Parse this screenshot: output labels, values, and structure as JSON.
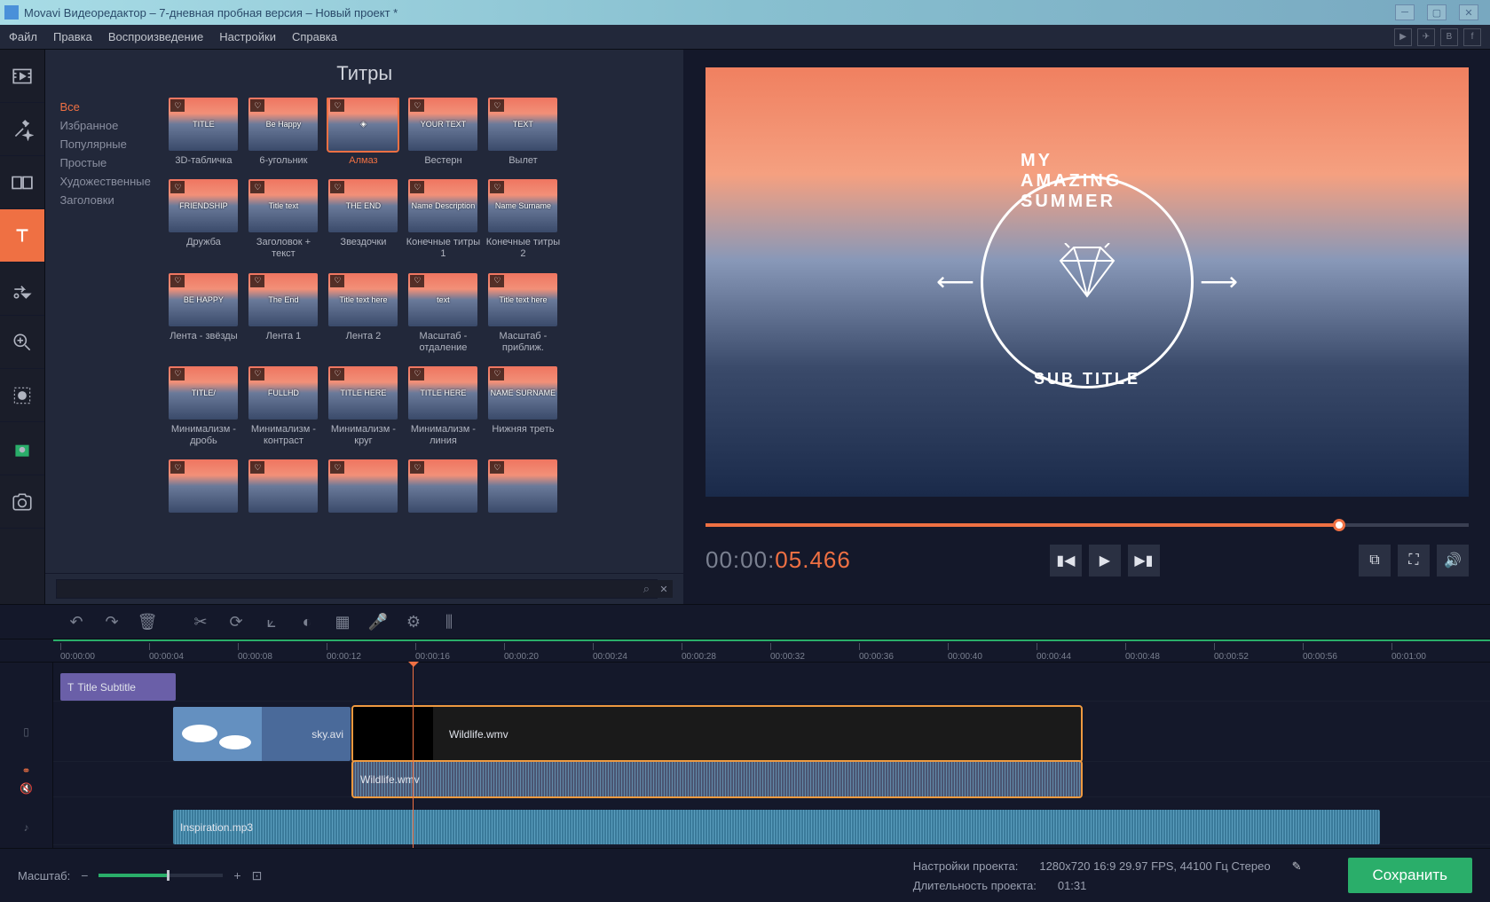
{
  "titlebar": {
    "text": "Movavi Видеоредактор – 7-дневная пробная версия – Новый проект *"
  },
  "menu": [
    "Файл",
    "Правка",
    "Воспроизведение",
    "Настройки",
    "Справка"
  ],
  "panel": {
    "title": "Титры",
    "categories": [
      "Все",
      "Избранное",
      "Популярные",
      "Простые",
      "Художественные",
      "Заголовки"
    ],
    "active_category": 0,
    "search_placeholder": ""
  },
  "titles": [
    {
      "name": "3D-табличка",
      "thumb": "TITLE"
    },
    {
      "name": "6-угольник",
      "thumb": "Be Happy"
    },
    {
      "name": "Алмаз",
      "thumb": "◈",
      "selected": true
    },
    {
      "name": "Вестерн",
      "thumb": "YOUR TEXT"
    },
    {
      "name": "Вылет",
      "thumb": "TEXT"
    },
    {
      "name": "Дружба",
      "thumb": "FRIENDSHIP"
    },
    {
      "name": "Заголовок + текст",
      "thumb": "Title text"
    },
    {
      "name": "Звездочки",
      "thumb": "THE END"
    },
    {
      "name": "Конечные титры 1",
      "thumb": "Name Description"
    },
    {
      "name": "Конечные титры 2",
      "thumb": "Name Surname"
    },
    {
      "name": "Лента - звёзды",
      "thumb": "BE HAPPY"
    },
    {
      "name": "Лента 1",
      "thumb": "The End"
    },
    {
      "name": "Лента 2",
      "thumb": "Title text here"
    },
    {
      "name": "Масштаб - отдаление",
      "thumb": "text"
    },
    {
      "name": "Масштаб - приближ.",
      "thumb": "Title text here"
    },
    {
      "name": "Минимализм - дробь",
      "thumb": "TITLE/"
    },
    {
      "name": "Минимализм - контраст",
      "thumb": "FULLHD"
    },
    {
      "name": "Минимализм - круг",
      "thumb": "TITLE HERE"
    },
    {
      "name": "Минимализм - линия",
      "thumb": "TITLE HERE"
    },
    {
      "name": "Нижняя треть",
      "thumb": "NAME SURNAME"
    },
    {
      "name": "",
      "thumb": ""
    },
    {
      "name": "",
      "thumb": ""
    },
    {
      "name": "",
      "thumb": ""
    },
    {
      "name": "",
      "thumb": ""
    },
    {
      "name": "",
      "thumb": ""
    }
  ],
  "preview": {
    "overlay_top": "MY AMAZING SUMMER",
    "overlay_bottom": "SUB TITLE",
    "timecode_gray": "00:00:",
    "timecode_orange": "05.466",
    "scrubber_percent": 83
  },
  "ruler": [
    "00:00:00",
    "00:00:04",
    "00:00:08",
    "00:00:12",
    "00:00:16",
    "00:00:20",
    "00:00:24",
    "00:00:28",
    "00:00:32",
    "00:00:36",
    "00:00:40",
    "00:00:44",
    "00:00:48",
    "00:00:52",
    "00:00:56",
    "00:01:00"
  ],
  "clips": {
    "title_clip": "Title Subtitle",
    "sky": "sky.avi",
    "wildlife": "Wildlife.wmv",
    "wildlife_audio": "Wildlife.wmv",
    "inspiration": "Inspiration.mp3"
  },
  "status": {
    "zoom_label": "Масштаб:",
    "proj_settings_label": "Настройки проекта:",
    "proj_settings_value": "1280x720 16:9 29.97 FPS, 44100 Гц Стерео",
    "proj_duration_label": "Длительность проекта:",
    "proj_duration_value": "01:31",
    "save": "Сохранить"
  }
}
